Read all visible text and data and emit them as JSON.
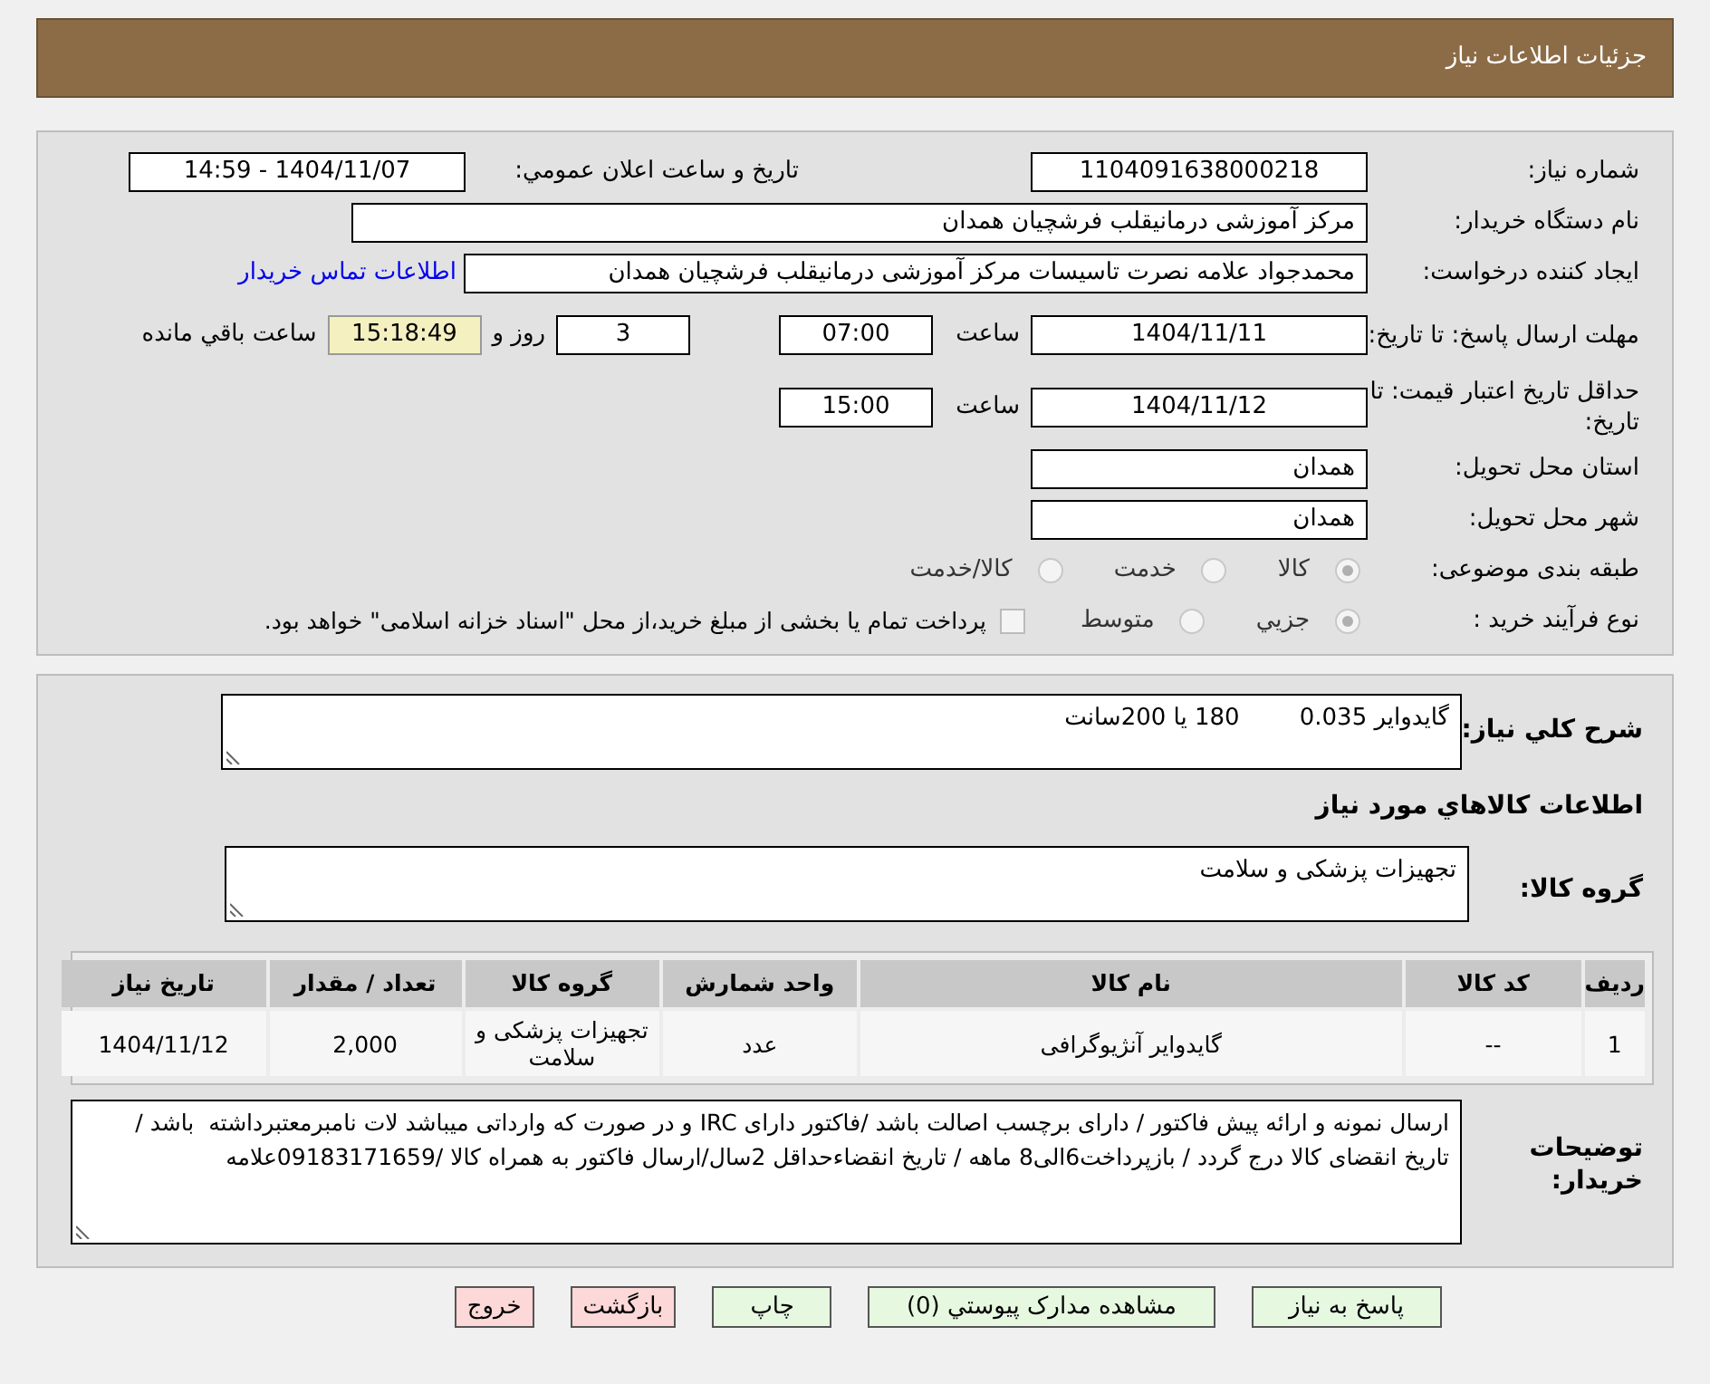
{
  "header": {
    "title": "جزئیات اطلاعات نیاز"
  },
  "need_number": {
    "label": "شماره نیاز:",
    "value": "1104091638000218"
  },
  "announce": {
    "label": "تاریخ و ساعت اعلان عمومي:",
    "value": "1404/11/07 - 14:59"
  },
  "buyer_org": {
    "label": "نام دستگاه خریدار:",
    "value": "مرکز آموزشی درمانیقلب فرشچیان همدان"
  },
  "creator": {
    "label": "ایجاد کننده درخواست:",
    "value": "محمدجواد علامه نصرت تاسیسات مرکز آموزشی درمانیقلب فرشچیان همدان",
    "link": "اطلاعات تماس خریدار"
  },
  "deadline": {
    "label": "مهلت ارسال پاسخ: تا تاریخ:",
    "date": "1404/11/11",
    "time_label": "ساعت",
    "time": "07:00",
    "days": "3",
    "days_label": "روز و",
    "remaining": "15:18:49",
    "remaining_label": "ساعت باقي مانده"
  },
  "validity": {
    "label": "حداقل تاریخ اعتبار قیمت: تا تاریخ:",
    "date": "1404/11/12",
    "time_label": "ساعت",
    "time": "15:00"
  },
  "province": {
    "label": "استان محل تحویل:",
    "value": "همدان"
  },
  "city": {
    "label": "شهر محل تحویل:",
    "value": "همدان"
  },
  "category": {
    "label": "طبقه بندی موضوعی:",
    "options": [
      {
        "label": "کالا",
        "selected": true
      },
      {
        "label": "خدمت",
        "selected": false
      },
      {
        "label": "کالا/خدمت",
        "selected": false
      }
    ]
  },
  "process": {
    "label": "نوع فرآیند خرید :",
    "options": [
      {
        "label": "جزيي",
        "selected": true
      },
      {
        "label": "متوسط",
        "selected": false
      }
    ],
    "treasury": {
      "checked": false,
      "text": "پرداخت تمام یا بخشی از مبلغ خرید،از محل \"اسناد خزانه اسلامی\" خواهد بود."
    }
  },
  "summary": {
    "label": "شرح کلي نیاز:",
    "value": "گایدوایر 0.035        180 یا 200سانت"
  },
  "items_heading": "اطلاعات کالاهاي مورد نیاز",
  "goods_group": {
    "label": "گروه کالا:",
    "value": "تجهیزات پزشکی و سلامت"
  },
  "table": {
    "columns": [
      "ردیف",
      "کد کالا",
      "نام کالا",
      "واحد شمارش",
      "گروه کالا",
      "تعداد / مقدار",
      "تاریخ نیاز"
    ],
    "rows": [
      [
        "1",
        "--",
        "گایدوایر آنژیوگرافی",
        "عدد",
        "تجهیزات پزشکی و سلامت",
        "2,000",
        "1404/11/12"
      ]
    ]
  },
  "notes": {
    "label": "توضیحات خریدار:",
    "value": "ارسال نمونه و ارائه پیش فاکتور / دارای برچسب اصالت باشد /فاکتور دارای IRC و در صورت که وارداتی میباشد لات نامبرمعتبرداشته  باشد / تاریخ انقضای کالا درج گردد / بازپرداخت6الی8 ماهه / تاریخ انقضاءحداقل 2سال/ارسال فاکتور به همراه کالا /09183171659علامه"
  },
  "buttons": [
    {
      "label": "پاسخ به نیاز",
      "kind": "action"
    },
    {
      "label": "مشاهده مدارک پیوستي (0)",
      "kind": "action"
    },
    {
      "label": "چاپ",
      "kind": "action"
    },
    {
      "label": "بازگشت",
      "kind": "exit"
    },
    {
      "label": "خروج",
      "kind": "exit"
    }
  ]
}
